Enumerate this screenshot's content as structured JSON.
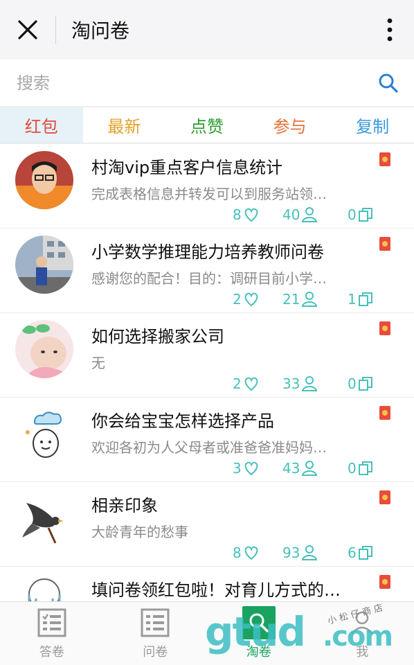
{
  "header": {
    "title": "淘问卷"
  },
  "search": {
    "placeholder": "搜索"
  },
  "tabs": [
    {
      "label": "红包",
      "color": "#e04b3c"
    },
    {
      "label": "最新",
      "color": "#e3a12b"
    },
    {
      "label": "点赞",
      "color": "#2f9e2f"
    },
    {
      "label": "参与",
      "color": "#e3733a"
    },
    {
      "label": "复制",
      "color": "#3a9ad9"
    }
  ],
  "items": [
    {
      "title": "村淘vip重点客户信息统计",
      "desc": "完成表格信息并转发可以到服务站领…",
      "likes": "8",
      "joins": "40",
      "copies": "0"
    },
    {
      "title": "小学数学推理能力培养教师问卷",
      "desc": "感谢您的配合！目的：调研目前小学…",
      "likes": "2",
      "joins": "21",
      "copies": "1"
    },
    {
      "title": "如何选择搬家公司",
      "desc": "无",
      "likes": "2",
      "joins": "33",
      "copies": "0"
    },
    {
      "title": "你会给宝宝怎样选择产品",
      "desc": "欢迎各初为人父母者或准爸爸准妈妈…",
      "likes": "3",
      "joins": "43",
      "copies": "0"
    },
    {
      "title": "相亲印象",
      "desc": "大龄青年的愁事",
      "likes": "8",
      "joins": "93",
      "copies": "6"
    },
    {
      "title": "填问卷领红包啦！对育儿方式的…",
      "desc": "",
      "likes": "",
      "joins": "",
      "copies": ""
    }
  ],
  "nav": [
    {
      "label": "答卷"
    },
    {
      "label": "问卷"
    },
    {
      "label": "淘卷"
    },
    {
      "label": "我"
    }
  ],
  "watermark": {
    "brand": "gtud",
    "domain": ".com",
    "hand": "小 松 仔 商 店"
  },
  "colors": {
    "accent": "#47c0b9",
    "nav_active": "#1aa260"
  }
}
